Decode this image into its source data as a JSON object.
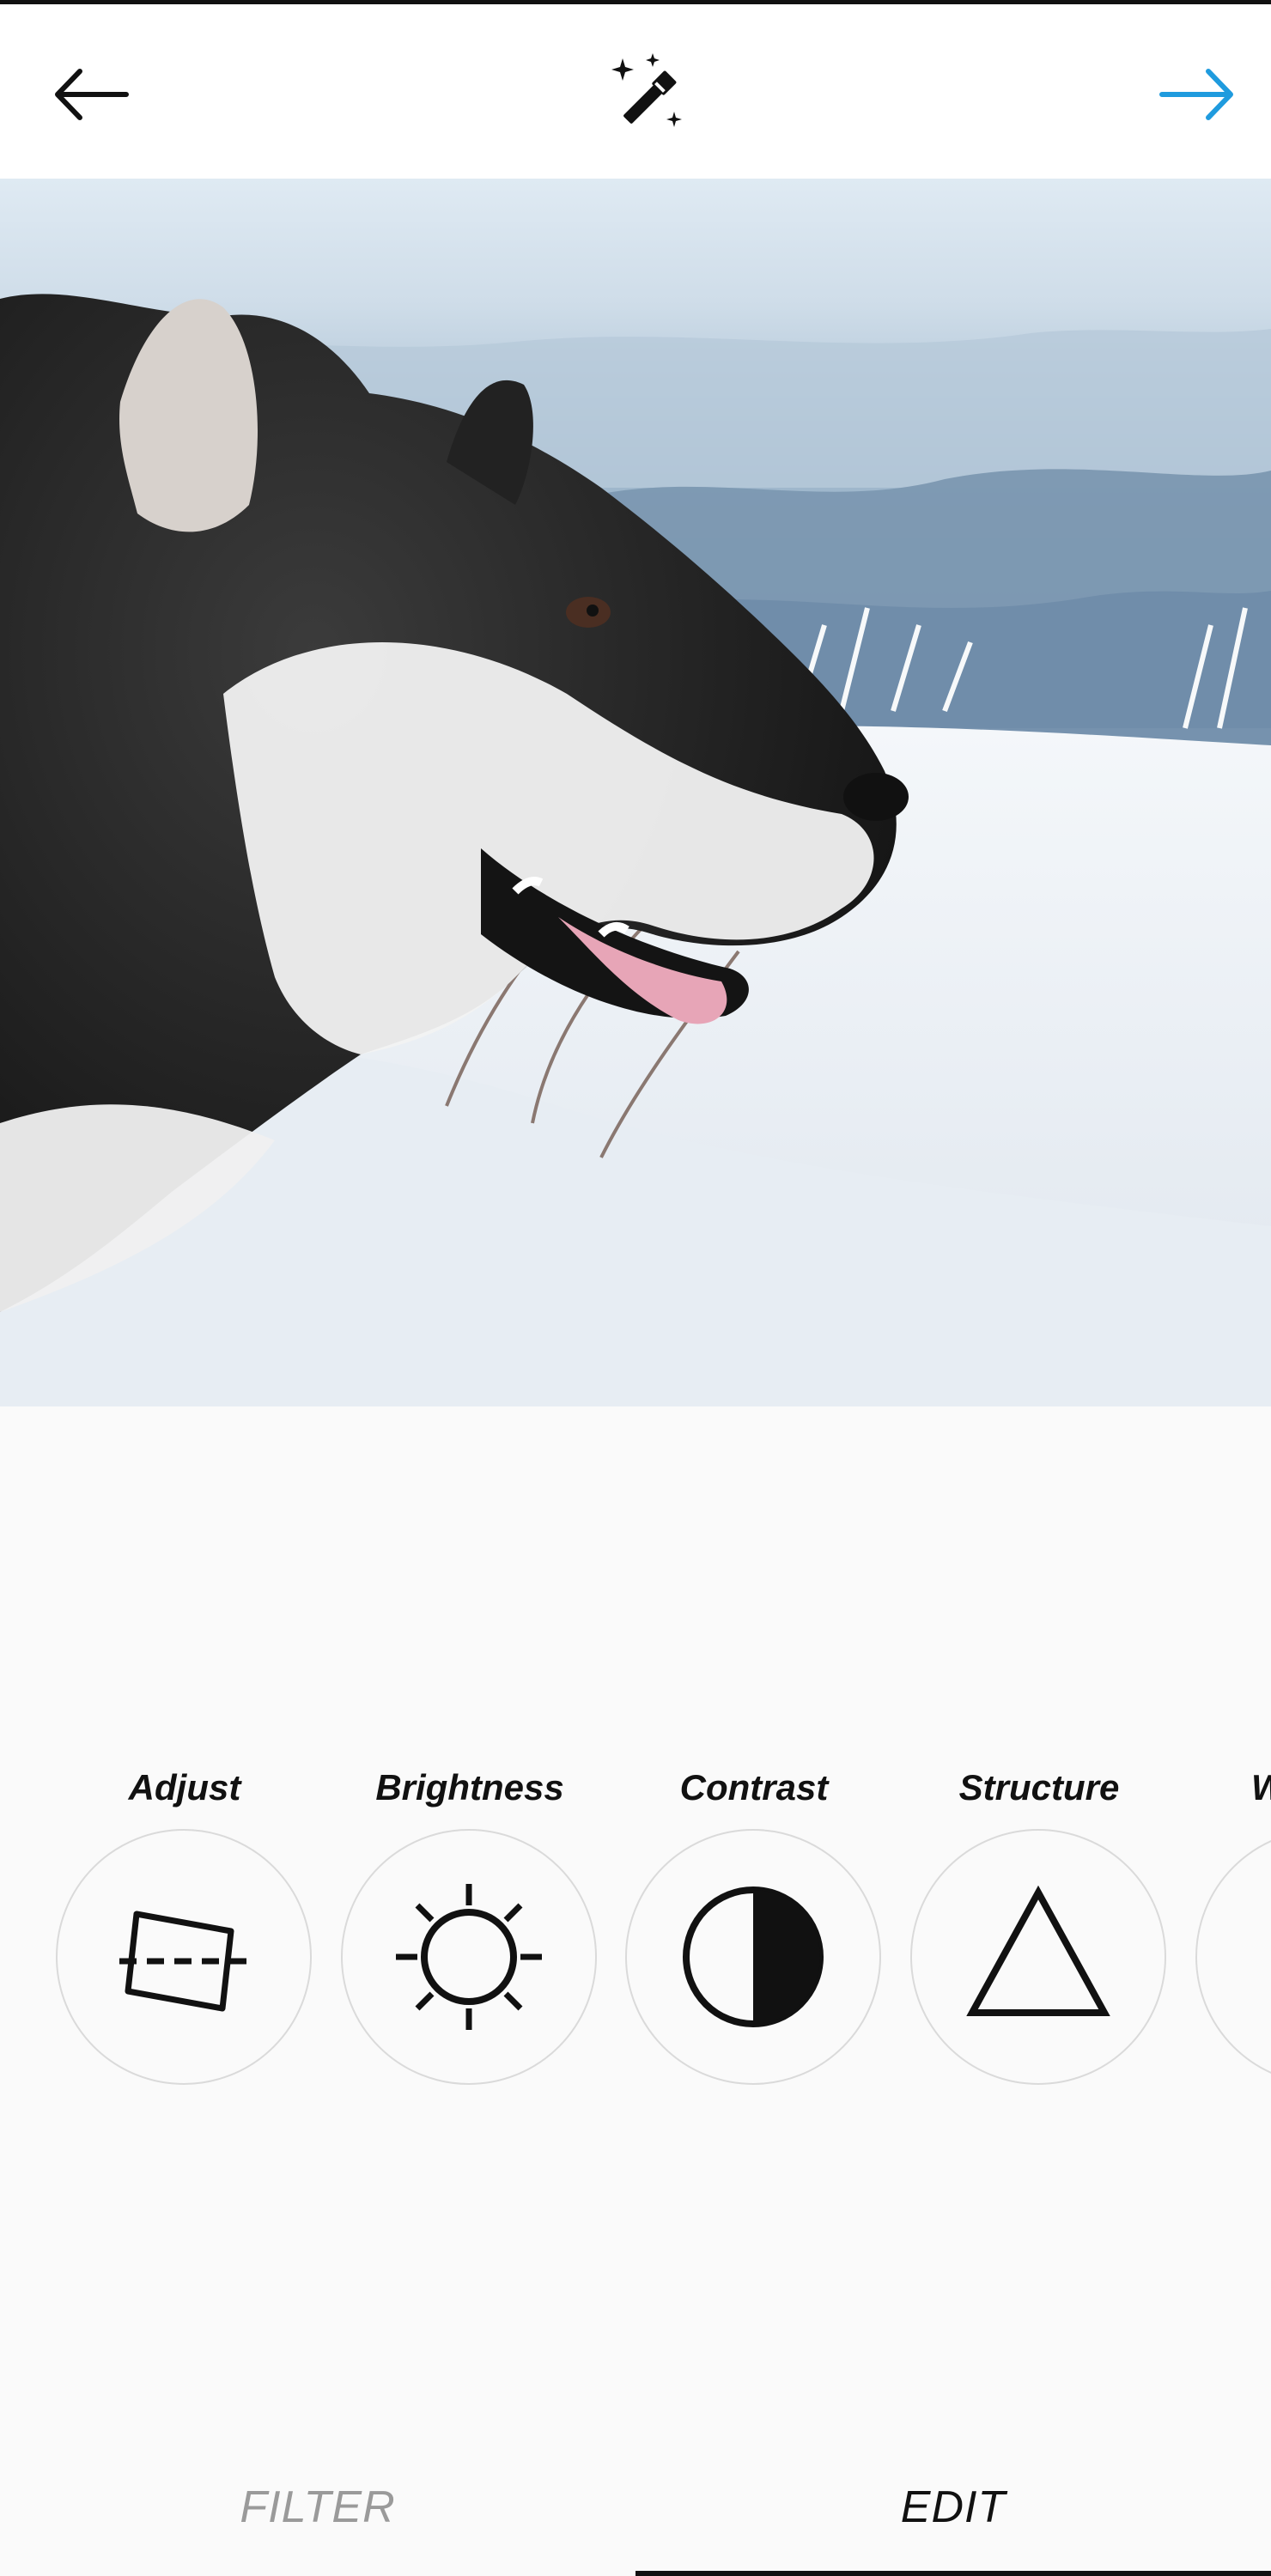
{
  "header": {
    "back_icon": "arrow-left-icon",
    "center_icon": "magic-wand-icon",
    "next_icon": "arrow-right-icon",
    "next_color": "#1f9bde"
  },
  "photo": {
    "subject": "dog-photo"
  },
  "tools": [
    {
      "label": "Adjust",
      "icon": "adjust-icon"
    },
    {
      "label": "Brightness",
      "icon": "sun-icon"
    },
    {
      "label": "Contrast",
      "icon": "contrast-icon"
    },
    {
      "label": "Structure",
      "icon": "triangle-icon"
    },
    {
      "label": "W",
      "icon": "partial-tool-icon"
    }
  ],
  "tabs": {
    "filter_label": "FILTER",
    "edit_label": "EDIT",
    "active": "EDIT"
  }
}
